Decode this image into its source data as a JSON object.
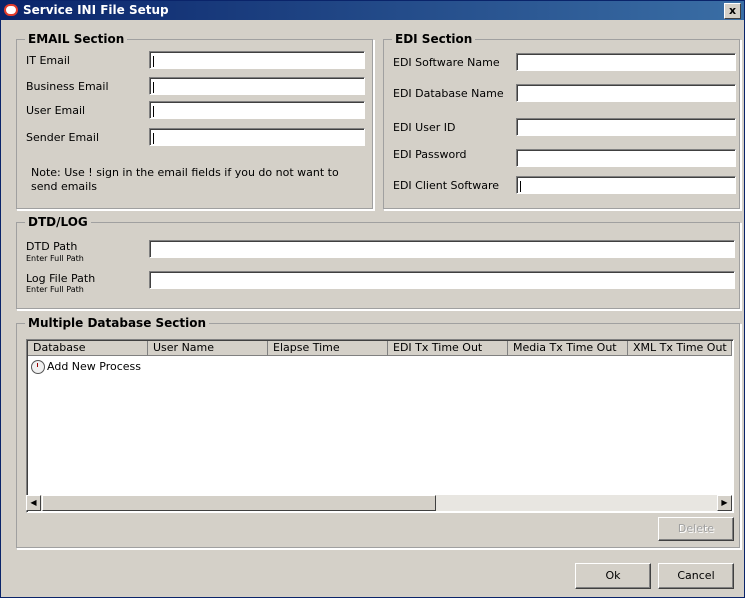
{
  "window": {
    "title": "Service INI File Setup",
    "close_label": "x"
  },
  "email": {
    "legend": "EMAIL Section",
    "it_email": "IT Email",
    "business_email": "Business Email",
    "user_email": "User Email",
    "sender_email": "Sender Email",
    "note": "Note: Use ! sign in the email fields if you do not want to send emails"
  },
  "edi": {
    "legend": "EDI Section",
    "software_name": "EDI Software Name",
    "database_name": "EDI Database Name",
    "user_id": "EDI User ID",
    "password": "EDI Password",
    "client_software": "EDI Client Software"
  },
  "dtd": {
    "legend": "DTD/LOG",
    "dtd_path": "DTD Path",
    "dtd_hint": "Enter Full Path",
    "log_path": "Log File Path",
    "log_hint": "Enter Full Path"
  },
  "multidb": {
    "legend": "Multiple Database Section",
    "columns": [
      "Database",
      "User Name",
      "Elapse Time",
      "EDI Tx Time Out",
      "Media Tx Time Out",
      "XML Tx Time Out"
    ],
    "add_row": "Add New Process",
    "delete_label": "Delete"
  },
  "buttons": {
    "ok": "Ok",
    "cancel": "Cancel"
  }
}
